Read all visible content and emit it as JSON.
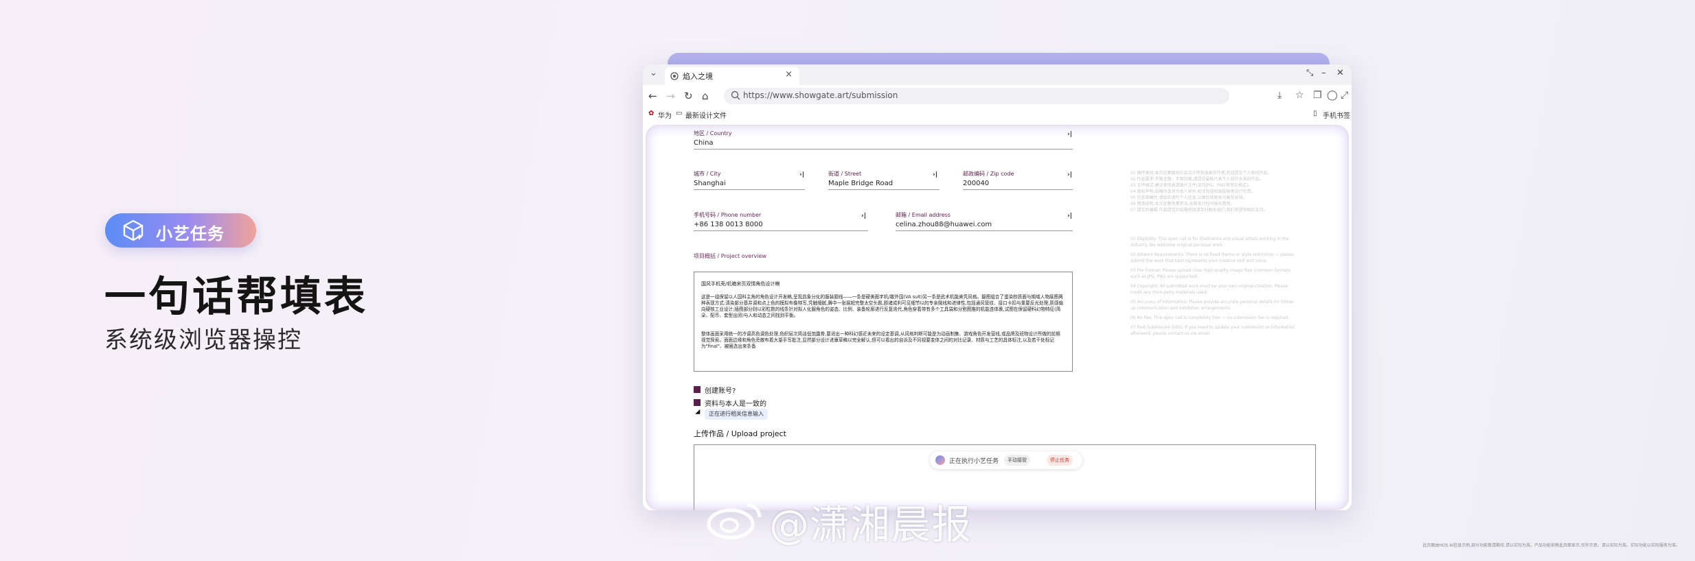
{
  "promo": {
    "badge_label": "小艺任务",
    "headline": "一句话帮填表",
    "subline": "系统级浏览器操控"
  },
  "browser": {
    "tab_title": "焰入之境",
    "url": "https://www.showgate.art/submission",
    "bookmarks": [
      "华为",
      "最新设计文件"
    ],
    "mobile_bookmarks": "手机书签"
  },
  "form": {
    "country_label": "地区 / Country",
    "country_value": "China",
    "city_label": "城市 / City",
    "city_value": "Shanghai",
    "street_label": "街道 / Street",
    "street_value": "Maple Bridge Road",
    "zip_label": "邮政编码 / Zip code",
    "zip_value": "200040",
    "phone_label": "手机号码 / Phone number",
    "phone_value": "+86 138 0013 8000",
    "email_label": "邮箱 / Email address",
    "email_value": "celina.zhou88@huawei.com",
    "overview_label": "项目概括 / Project overview",
    "overview_title": "国风手机壳/机箱宋页双情角色设计稿",
    "overview_p1": "这是一组保留以人国科主角的角色设计开发稿,呈现具象分化的服装题线——一条是硬美面字机/敢外国(VA sult)另一条是武术机能美凭风格。摄图组合了蛋染棕质面与期域人物展图两种表现方式:清染部分基并调和点上色的模拟布像特写,凭触细腻,舞中一张展超完整太空头题,题诸成利可见细节以的专亲微线和进律性,包括通风管纹、接口卡扣与重要反光处理,质感偏向硬核工业设计;插图部分则以彩粒数的线条针对拟人化服角色的姿态、比例、装备轮廓进行反复迭代,角色穿着带有多个工具袋和分割图推的机能连体裹,试图在保留硬科幻物特征(简朵、配币、套型出闭)与人和动态之间找到平衡。",
    "overview_p2": "整体画面采用统一的冷调高色调色处理,色织层次简洁低饱露骨,要适出一种科幻感近未来的设定基调,从风格判断可能是为动画制集、游戏角色开发营线,或品牌及班物设计所做的前期视觉探索。面面边缘和角色旁散布着大量手写批注,显然部分设计进康草稿以完全解认,但可以看出的自诉及不同视要变体之间的对比记录、材质与工艺的具体标注,以及若干处标记为\"final\"、被圈选出来条备",
    "checkbox1_label": "创建账号?",
    "checkbox2_label": "资料与本人是一致的",
    "tooltip": "正在进行相关信息输入",
    "upload_label": "上传作品 / Upload project"
  },
  "rules_cn": [
    "01 稿件类别:本次征集面向社会设计师及插画创作者,欢迎提交个人原创作品。",
    "02 作品要求:不限主题、不限风格,请提交最能代表个人创作水准的作品。",
    "03 文件格式:建议使用高清图片文件(支持JPG、PNG等常见格式)。",
    "04 版权声明:投稿作品须为本人原创,如涉及侵权由投稿者自行负责。",
    "05 信息准确性:请如实填写个人信息,以便后续联系与展览安排。",
    "06 费用说明:本次征集免费参加,无需支付任何报名费用。",
    "07 提交后编辑:作品提交后如需修改请及时联系我们,我们将提供相应支持。"
  ],
  "rules_en": [
    "01 Eligibility: This open call is for illustrators and visual artists working in the industry. We welcome original personal work.",
    "02 Artwork Requirements: There is no fixed theme or style restriction — please submit the work that best represents your creative skill and voice.",
    "03 File Format: Please upload clear high-quality image files (common formats such as JPG, PNG are supported).",
    "04 Copyright: All submitted work must be your own original creation. Please credit any third-party materials used.",
    "05 Accuracy of Information: Please provide accurate personal details for follow-up communication and exhibition arrangements.",
    "06 No Fee: This open call is completely free — no submission fee is required.",
    "07 Post-Submission Edits: If you need to update your submission or information afterward, please contact us via email."
  ],
  "task_pill": {
    "status": "正在执行小艺任务",
    "manual": "手动接管",
    "stop": "停止任务"
  },
  "watermark": "@潇湘晨报",
  "footnote": "此页面由HOS AI信息示例,部分功能敬请期待,请以实际为准。产品功能依赖此页面显示,仅作示意。请以实际为准。实际功能以实际服务为准。"
}
